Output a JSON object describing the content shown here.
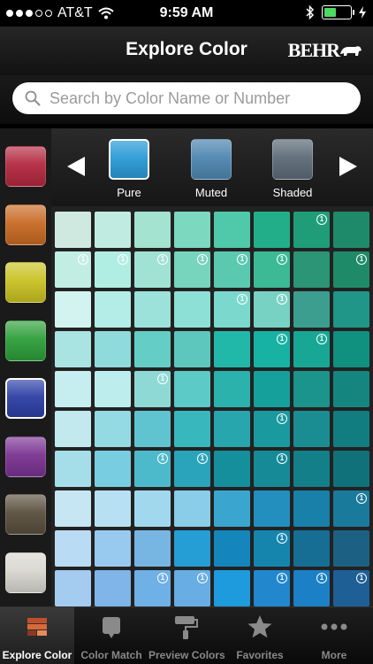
{
  "status_bar": {
    "carrier": "AT&T",
    "time": "9:59 AM",
    "battery_color": "#4cd964"
  },
  "header": {
    "title": "Explore Color",
    "logo_text": "BEHR"
  },
  "search": {
    "placeholder": "Search by Color Name or Number",
    "value": ""
  },
  "families": [
    {
      "name": "red",
      "color": "#b3283f"
    },
    {
      "name": "orange",
      "color": "#c86a24"
    },
    {
      "name": "yellow",
      "color": "#c9c223"
    },
    {
      "name": "green",
      "color": "#2e9e3a"
    },
    {
      "name": "blue",
      "color": "#2d3fa5",
      "selected": true
    },
    {
      "name": "purple",
      "color": "#7a3391"
    },
    {
      "name": "neutral-brown",
      "color": "#5a4f3e"
    },
    {
      "name": "white",
      "color": "#d8d6cf"
    }
  ],
  "intensity": {
    "options": [
      {
        "label": "Pure",
        "color": "#2b9bd6",
        "selected": true
      },
      {
        "label": "Muted",
        "color": "#4f86b0"
      },
      {
        "label": "Shaded",
        "color": "#5d6b78"
      }
    ]
  },
  "grid": {
    "badge_text": "1",
    "rows": [
      [
        [
          "#cfe9e1",
          0
        ],
        [
          "#c0ebe0",
          0
        ],
        [
          "#a3e3d0",
          0
        ],
        [
          "#7dd8c0",
          0
        ],
        [
          "#50c9aa",
          0
        ],
        [
          "#22ae88",
          0
        ],
        [
          "#1f9d78",
          1
        ],
        [
          "#1e8a69",
          0
        ]
      ],
      [
        [
          "#c2ede3",
          1
        ],
        [
          "#b0eee3",
          1
        ],
        [
          "#a0e2d3",
          1
        ],
        [
          "#77d4bd",
          1
        ],
        [
          "#5bc9b0",
          1
        ],
        [
          "#3cb995",
          1
        ],
        [
          "#2b9575",
          0
        ],
        [
          "#1f8a67",
          1
        ]
      ],
      [
        [
          "#d2f3ef",
          0
        ],
        [
          "#b4ede7",
          0
        ],
        [
          "#9ce1da",
          0
        ],
        [
          "#8de0d6",
          0
        ],
        [
          "#7bd8cd",
          1
        ],
        [
          "#78d2c3",
          1
        ],
        [
          "#3c9e8e",
          0
        ],
        [
          "#1f9687",
          0
        ]
      ],
      [
        [
          "#a9e3e2",
          0
        ],
        [
          "#8fdadb",
          0
        ],
        [
          "#64cec6",
          0
        ],
        [
          "#5dc7be",
          0
        ],
        [
          "#21b8aa",
          0
        ],
        [
          "#17b2a3",
          1
        ],
        [
          "#18a795",
          1
        ],
        [
          "#10907f",
          0
        ]
      ],
      [
        [
          "#c6eef0",
          0
        ],
        [
          "#bdeded",
          0
        ],
        [
          "#8fd9d5",
          1
        ],
        [
          "#5ccac6",
          0
        ],
        [
          "#2bb2ac",
          0
        ],
        [
          "#16a09b",
          0
        ],
        [
          "#1b948c",
          0
        ],
        [
          "#14867f",
          0
        ]
      ],
      [
        [
          "#c1e9ee",
          0
        ],
        [
          "#94dae2",
          0
        ],
        [
          "#5fc4cf",
          0
        ],
        [
          "#38b8bd",
          0
        ],
        [
          "#27a7ad",
          0
        ],
        [
          "#1a999e",
          1
        ],
        [
          "#1a8d93",
          0
        ],
        [
          "#127d80",
          0
        ]
      ],
      [
        [
          "#a5dee8",
          0
        ],
        [
          "#79cde0",
          0
        ],
        [
          "#4dbacb",
          1
        ],
        [
          "#2aa4bb",
          1
        ],
        [
          "#168f9d",
          0
        ],
        [
          "#168b97",
          1
        ],
        [
          "#137f89",
          0
        ],
        [
          "#11717a",
          0
        ]
      ],
      [
        [
          "#c6e6f4",
          0
        ],
        [
          "#b7e1f3",
          0
        ],
        [
          "#a1d8ee",
          0
        ],
        [
          "#89cde8",
          0
        ],
        [
          "#3aa6d0",
          0
        ],
        [
          "#238fbe",
          0
        ],
        [
          "#1880a9",
          0
        ],
        [
          "#1a7a9b",
          1
        ]
      ],
      [
        [
          "#b9dbf4",
          0
        ],
        [
          "#98c9ef",
          0
        ],
        [
          "#77b5e3",
          0
        ],
        [
          "#259ed5",
          0
        ],
        [
          "#1586bc",
          0
        ],
        [
          "#1685ae",
          1
        ],
        [
          "#166e95",
          0
        ],
        [
          "#1c6183",
          0
        ]
      ],
      [
        [
          "#a4cbf0",
          0
        ],
        [
          "#7fb5e8",
          0
        ],
        [
          "#6fb0e7",
          1
        ],
        [
          "#68ade4",
          1
        ],
        [
          "#1d9bdc",
          0
        ],
        [
          "#2287cc",
          1
        ],
        [
          "#1b80c6",
          1
        ],
        [
          "#1e5f95",
          1
        ]
      ]
    ]
  },
  "tabs": [
    {
      "label": "Explore Color",
      "active": true
    },
    {
      "label": "Color Match"
    },
    {
      "label": "Preview Colors"
    },
    {
      "label": "Favorites"
    },
    {
      "label": "More"
    }
  ]
}
